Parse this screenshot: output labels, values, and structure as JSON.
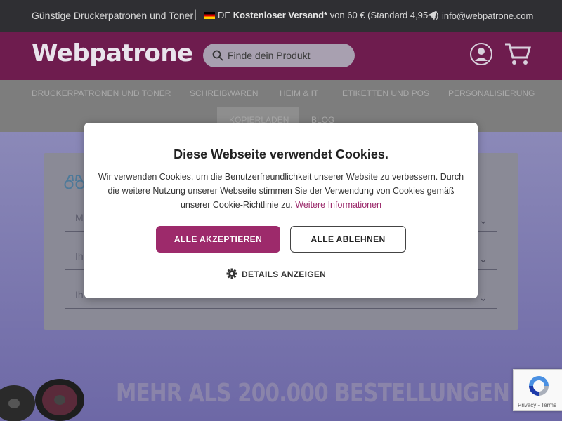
{
  "topbar": {
    "tagline": "Günstige Druckerpatronen und Toner",
    "separator": "|",
    "country": "DE",
    "shipping_bold": "Kostenloser Versand*",
    "shipping_rest": " von 60 € (Standard 4,95 €)",
    "email": "info@webpatrone.com"
  },
  "header": {
    "logo": "Webpatrone",
    "search_placeholder": "Finde dein Produkt"
  },
  "nav": {
    "items": [
      "Druckerpatronen und Toner",
      "Schreibwaren",
      "Heim & IT",
      "Etiketten und POS",
      "Personalisierung",
      "Kopierladen",
      "Blog"
    ]
  },
  "finder": {
    "field1": "M",
    "field2": "Ih",
    "field3": "Ih"
  },
  "banner": {
    "headline": "MEHR ALS 200.000 BESTELLUNGEN"
  },
  "recaptcha": {
    "text": "Privacy - Terms"
  },
  "cookie": {
    "title": "Diese Webseite verwendet Cookies.",
    "body": "Wir verwenden Cookies, um die Benutzerfreundlichkeit unserer Website zu verbessern. Durch die weitere Nutzung unserer Webseite stimmen Sie der Verwendung von Cookies gemäß unserer Cookie-Richtlinie zu.",
    "link": "Weitere Informationen",
    "accept": "ALLE AKZEPTIEREN",
    "decline": "ALLE ABLEHNEN",
    "details": "DETAILS ANZEIGEN"
  },
  "colors": {
    "brand": "#9d2a6b",
    "header_bg": "#6e1c4e",
    "topbar_bg": "#2f2f33"
  }
}
